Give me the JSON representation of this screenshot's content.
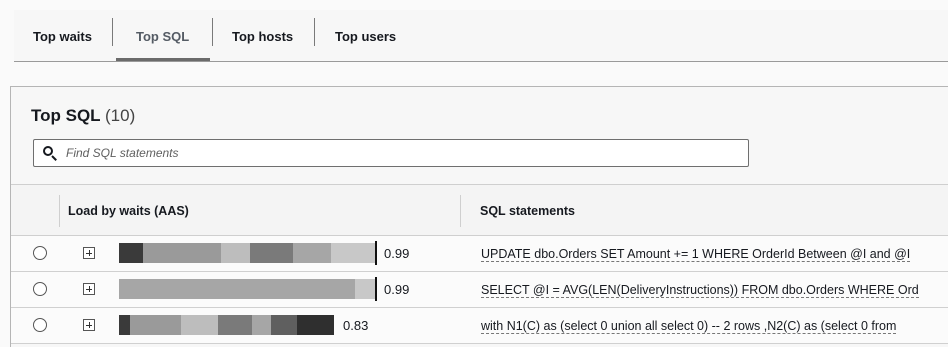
{
  "tabs": [
    {
      "label": "Top waits"
    },
    {
      "label": "Top SQL",
      "selected": true
    },
    {
      "label": "Top hosts"
    },
    {
      "label": "Top users"
    }
  ],
  "panel": {
    "title": "Top SQL",
    "count": "(10)",
    "search_placeholder": "Find SQL statements"
  },
  "table": {
    "columns": [
      "Load by waits (AAS)",
      "SQL statements"
    ],
    "rows": [
      {
        "load": "0.99",
        "segments": [
          {
            "fraction": 0.095,
            "color": "#3a3a3a"
          },
          {
            "fraction": 0.305,
            "color": "#9a9a9a"
          },
          {
            "fraction": 0.11,
            "color": "#bdbdbd"
          },
          {
            "fraction": 0.17,
            "color": "#7a7a7a"
          },
          {
            "fraction": 0.15,
            "color": "#a6a6a6"
          },
          {
            "fraction": 0.17,
            "color": "#c8c8c8"
          }
        ],
        "sql": "UPDATE dbo.Orders SET Amount += 1 WHERE OrderId Between @I and @I"
      },
      {
        "load": "0.99",
        "segments": [
          {
            "fraction": 0.92,
            "color": "#a6a6a6"
          },
          {
            "fraction": 0.08,
            "color": "#c8c8c8"
          }
        ],
        "sql": "SELECT @I = AVG(LEN(DeliveryInstructions)) FROM dbo.Orders WHERE Ord"
      },
      {
        "load": "0.83",
        "segments": [
          {
            "fraction": 0.05,
            "color": "#3a3a3a"
          },
          {
            "fraction": 0.24,
            "color": "#9a9a9a"
          },
          {
            "fraction": 0.17,
            "color": "#bdbdbd"
          },
          {
            "fraction": 0.16,
            "color": "#7a7a7a"
          },
          {
            "fraction": 0.09,
            "color": "#a6a6a6"
          },
          {
            "fraction": 0.12,
            "color": "#5f5f5f"
          },
          {
            "fraction": 0.17,
            "color": "#2f2f2f"
          }
        ],
        "sql": "with N1(C) as (select 0 union all select 0) -- 2 rows ,N2(C) as (select 0 from"
      }
    ]
  }
}
